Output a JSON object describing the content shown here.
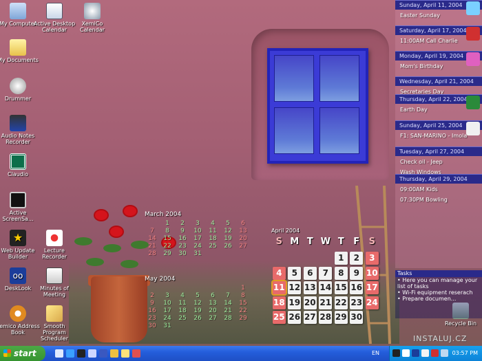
{
  "desktop": {
    "icons": [
      {
        "label": "My Computer",
        "icon": "computer-icon"
      },
      {
        "label": "Active Desktop Calendar",
        "icon": "calendar-icon"
      },
      {
        "label": "XemiCo Calendar",
        "icon": "xemico-icon"
      },
      {
        "label": "My Documents",
        "icon": "documents-folder-icon"
      },
      {
        "label": "Drummer",
        "icon": "drum-icon"
      },
      {
        "label": "Audio Notes Recorder",
        "icon": "audio-notes-icon"
      },
      {
        "label": "Claudio",
        "icon": "claudio-icon"
      },
      {
        "label": "Active ScreenSa...",
        "icon": "screensaver-icon"
      },
      {
        "label": "Web Update Builder",
        "icon": "web-update-icon"
      },
      {
        "label": "Lecture Recorder",
        "icon": "lecture-recorder-icon"
      },
      {
        "label": "DeskLook",
        "icon": "desklook-icon"
      },
      {
        "label": "Minutes of Meeting",
        "icon": "minutes-icon"
      },
      {
        "label": "Xemico Address Book",
        "icon": "address-book-icon"
      },
      {
        "label": "Smooth Program Scheduler",
        "icon": "scheduler-icon"
      },
      {
        "label": "Recycle Bin",
        "icon": "recycle-bin-icon"
      }
    ]
  },
  "calendars": {
    "march": {
      "title": "March 2004",
      "days": [
        "1",
        "2",
        "3",
        "4",
        "5",
        "6",
        "7",
        "8",
        "9",
        "10",
        "11",
        "12",
        "13",
        "14",
        "15",
        "16",
        "17",
        "18",
        "19",
        "20",
        "21",
        "22",
        "23",
        "24",
        "25",
        "26",
        "27",
        "28",
        "29",
        "30",
        "31"
      ]
    },
    "may": {
      "title": "May 2004",
      "days": [
        "1",
        "2",
        "3",
        "4",
        "5",
        "6",
        "7",
        "8",
        "9",
        "10",
        "11",
        "12",
        "13",
        "14",
        "15",
        "16",
        "17",
        "18",
        "19",
        "20",
        "21",
        "22",
        "23",
        "24",
        "25",
        "26",
        "27",
        "28",
        "29",
        "30",
        "31"
      ]
    },
    "april": {
      "title": "April 2004",
      "weekdays": [
        "S",
        "M",
        "T",
        "W",
        "T",
        "F",
        "S"
      ],
      "days": [
        "1",
        "2",
        "3",
        "4",
        "5",
        "6",
        "7",
        "8",
        "9",
        "10",
        "11",
        "12",
        "13",
        "14",
        "15",
        "16",
        "17",
        "18",
        "19",
        "20",
        "21",
        "22",
        "23",
        "24",
        "25",
        "26",
        "27",
        "28",
        "29",
        "30"
      ],
      "today": "11"
    }
  },
  "agenda": [
    {
      "date": "Sunday, April 11, 2004",
      "items": [
        "Easter Sunday"
      ],
      "icon": "easter-egg-icon"
    },
    {
      "date": "Saturday, April 17, 2004",
      "items": [
        "11:00AM Call Charlie"
      ],
      "icon": "telephone-icon"
    },
    {
      "date": "Monday, April 19, 2004",
      "items": [
        "Mom's Birthday"
      ],
      "icon": "gift-icon"
    },
    {
      "date": "Wednesday, April 21, 2004",
      "items": [
        "Secretaries Day"
      ],
      "icon": ""
    },
    {
      "date": "Thursday, April 22, 2004",
      "items": [
        "Earth Day"
      ],
      "icon": "globe-icon"
    },
    {
      "date": "Sunday, April 25, 2004",
      "items": [
        "F1: SAN-MARINO - Imola"
      ],
      "icon": "race-car-icon"
    },
    {
      "date": "Tuesday, April 27, 2004",
      "items": [
        "Check oil - Jeep",
        "Wash Windows"
      ],
      "icon": ""
    },
    {
      "date": "Thursday, April 29, 2004",
      "items": [
        "09:00AM Kids",
        "07:30PM Bowling"
      ],
      "icon": ""
    }
  ],
  "tasks": {
    "title": "Tasks",
    "items": [
      "Here you can manage your list of tasks",
      "Wi-Fi equipment reserach",
      "Prepare documen..."
    ]
  },
  "watermark": "INSTALUJ.CZ",
  "taskbar": {
    "start_label": "start",
    "language": "EN",
    "clock": "03:57 PM",
    "colors": {
      "start": "#3c9c35",
      "bar": "#245edb",
      "tray": "#0f8fe0"
    }
  }
}
